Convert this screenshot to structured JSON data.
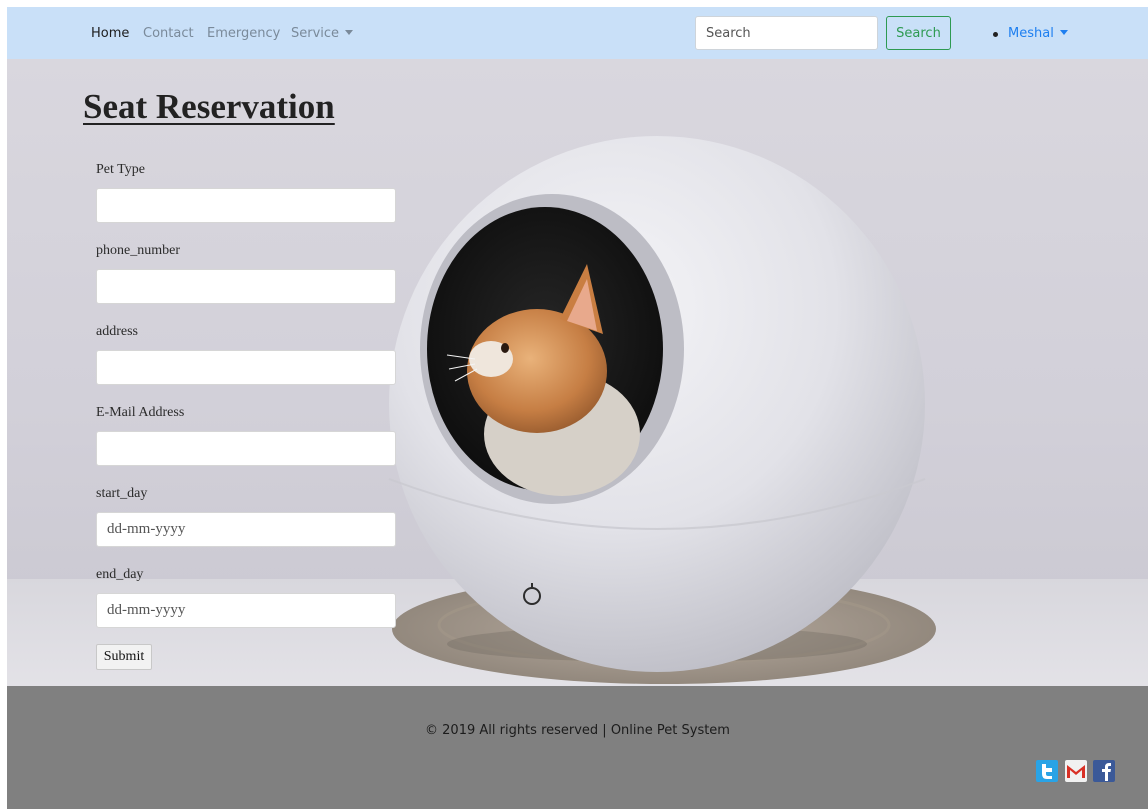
{
  "navbar": {
    "links": [
      {
        "label": "Home"
      },
      {
        "label": "Contact"
      },
      {
        "label": "Emergency"
      },
      {
        "label": "Service"
      }
    ],
    "search": {
      "placeholder": "Search",
      "button_label": "Search"
    },
    "user_label": "Meshal"
  },
  "form": {
    "title": "Seat Reservation",
    "fields": [
      {
        "label": "Pet Type",
        "value": "",
        "placeholder": ""
      },
      {
        "label": "phone_number",
        "value": "",
        "placeholder": ""
      },
      {
        "label": "address",
        "value": "",
        "placeholder": ""
      },
      {
        "label": "E-Mail Address",
        "value": "",
        "placeholder": ""
      },
      {
        "label": "start_day",
        "value": "",
        "placeholder": "dd-mm-yyyy"
      },
      {
        "label": "end_day",
        "value": "",
        "placeholder": "dd-mm-yyyy"
      }
    ],
    "submit_label": "Submit"
  },
  "footer": {
    "copyright": "© 2019 All rights reserved | Online Pet System",
    "social_icons": [
      "twitter-icon",
      "gmail-icon",
      "facebook-icon"
    ]
  },
  "colors": {
    "navbar_bg": "#c9e0f8",
    "footer_bg": "#808080",
    "search_button": "#2e9a52",
    "user_link": "#1e7ff0"
  }
}
